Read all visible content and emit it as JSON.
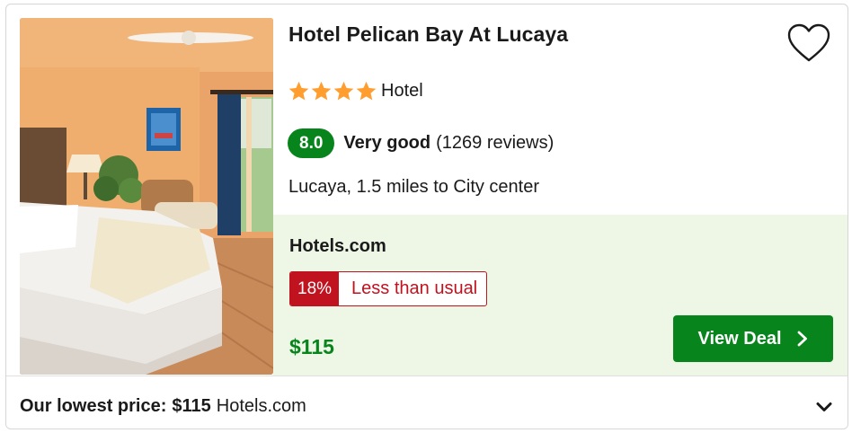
{
  "hotel": {
    "name": "Hotel Pelican Bay At Lucaya",
    "star_count": 4,
    "star_type": "Hotel",
    "score": "8.0",
    "rating_label": "Very good",
    "reviews": "(1269 reviews)",
    "location": "Lucaya, 1.5 miles to City center"
  },
  "deal": {
    "provider": "Hotels.com",
    "discount_percent": "18%",
    "discount_label": "Less than usual",
    "price": "$115",
    "button_label": "View Deal"
  },
  "footer": {
    "label": "Our lowest price:",
    "price": "$115",
    "provider": "Hotels.com"
  },
  "colors": {
    "brand_green": "#08841c",
    "deal_bg": "#eef6e6",
    "alert_red": "#c1121f",
    "star": "#ff9d2e"
  },
  "icons": {
    "favorite": "heart-icon",
    "star": "star-icon",
    "button": "chevron-right-icon",
    "expand": "chevron-down-icon"
  }
}
